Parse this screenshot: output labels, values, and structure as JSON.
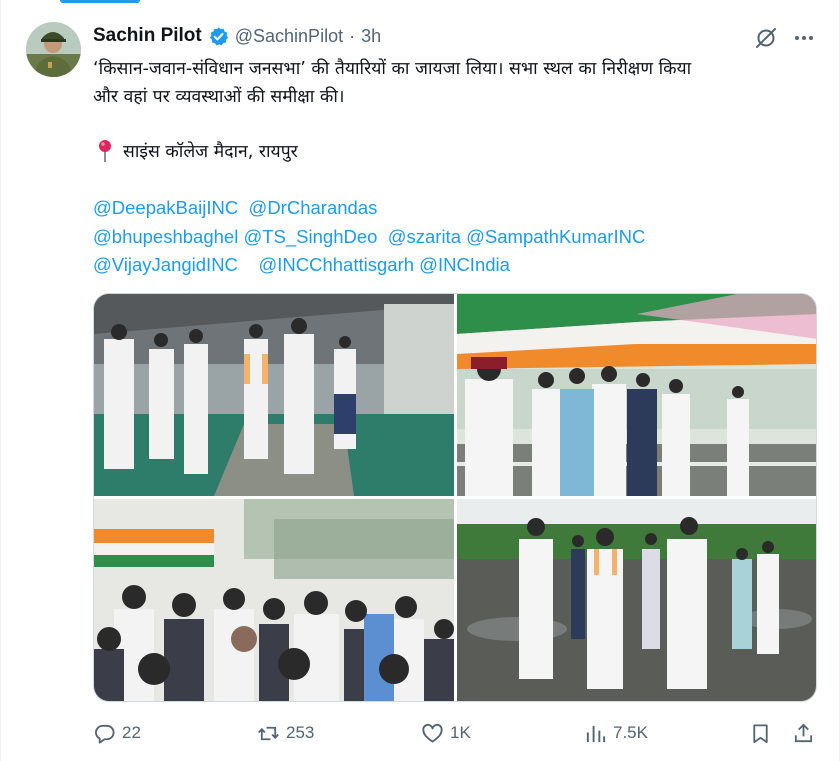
{
  "tweet": {
    "author_name": "Sachin Pilot",
    "handle": "@SachinPilot",
    "separator": "·",
    "time": "3h",
    "text_lines": [
      "‘किसान-जवान-संविधान जनसभा’ की तैयारियों का जायजा लिया। सभा स्थल का निरीक्षण किया",
      "और वहां पर व्यवस्थाओं की समीक्षा की।"
    ],
    "location": "साइंस कॉलेज मैदान, रायपुर",
    "mentions": {
      "line1": [
        "@DeepakBaijINC",
        "@DrCharandas"
      ],
      "line2": [
        "@bhupeshbaghel",
        "@TS_SinghDeo",
        "@szarita",
        "@SampathKumarINC"
      ],
      "line3": [
        "@VijayJangidINC",
        "@INCChhattisgarh",
        "@INCIndia"
      ]
    }
  },
  "actions": {
    "replies": "22",
    "reposts": "253",
    "likes": "1K",
    "views": "7.5K"
  },
  "icons": {
    "verified": "verified-badge-icon",
    "grok": "grok-icon",
    "more": "more-icon",
    "pin": "round-pushpin-icon",
    "reply": "reply-icon",
    "repost": "repost-icon",
    "like": "heart-icon",
    "views": "views-icon",
    "bookmark": "bookmark-icon",
    "share": "share-icon"
  },
  "colors": {
    "accent": "#1d9bf0",
    "text": "#0f1419",
    "muted": "#536471",
    "border": "#cfd9de"
  }
}
